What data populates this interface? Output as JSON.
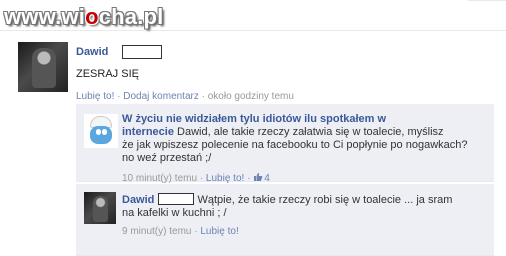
{
  "watermark": {
    "text_prefix": "www.wi",
    "text_o": "o",
    "text_suffix": "cha.pl"
  },
  "post": {
    "author": "Dawid",
    "text": "ZESRAJ SIĘ",
    "like": "Lubię to!",
    "sep1": " · ",
    "comment": "Dodaj komentarz",
    "sep2": " · ",
    "time": "około godziny temu"
  },
  "comments": [
    {
      "group_line1": "W życiu nie widziałem tylu idiotów ilu spotkałem w",
      "group_line2_bold": "internecie",
      "line2_rest": " Dawid, ale takie rzeczy załatwia się w toalecie, myślisz",
      "line3": "że jak wpiszesz polecenie na facebooku to Ci popłynie po nogawkach?",
      "line4": "no weź przestań ;/",
      "time": "10 minut(y) temu",
      "sep": " · ",
      "like": "Lubię to!",
      "sep2": " · ",
      "likes_count": "4",
      "thumb_icon": "thumbs-up-icon"
    },
    {
      "author": "Dawid",
      "line1": "Wątpie, że takie rzeczy robi się w toalecie ... ja sram",
      "line2": "na kafelki w kuchni ; /",
      "time": "9 minut(y) temu",
      "sep": " · ",
      "like": "Lubię to!"
    }
  ],
  "colors": {
    "link": "#3b5998",
    "meta_link": "#6d84b4",
    "comment_bg": "#edeff4",
    "watermark_accent": "#c40000"
  }
}
